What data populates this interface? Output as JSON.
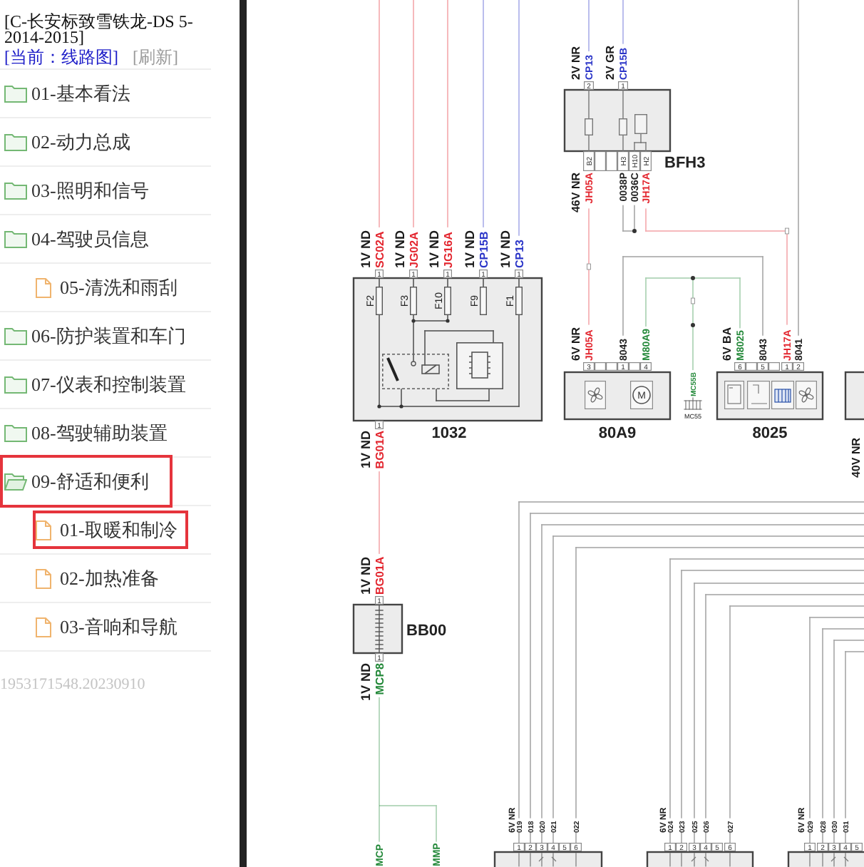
{
  "sidebar": {
    "title_lines": [
      "[C-长安标致雪铁龙-DS 5-",
      "2014-2015]"
    ],
    "current": "[当前：线路图]",
    "refresh": "[刷新]",
    "items": [
      {
        "kind": "folder",
        "label": "01-基本看法",
        "expanded": false,
        "highlighted": false
      },
      {
        "kind": "folder",
        "label": "02-动力总成",
        "expanded": false,
        "highlighted": false
      },
      {
        "kind": "folder",
        "label": "03-照明和信号",
        "expanded": false,
        "highlighted": false
      },
      {
        "kind": "folder",
        "label": "04-驾驶员信息",
        "expanded": false,
        "highlighted": false
      },
      {
        "kind": "file",
        "label": "05-清洗和雨刮",
        "highlighted": false
      },
      {
        "kind": "folder",
        "label": "06-防护装置和车门",
        "expanded": false,
        "highlighted": false
      },
      {
        "kind": "folder",
        "label": "07-仪表和控制装置",
        "expanded": false,
        "highlighted": false
      },
      {
        "kind": "folder",
        "label": "08-驾驶辅助装置",
        "expanded": false,
        "highlighted": false
      },
      {
        "kind": "folder",
        "label": "09-舒适和便利",
        "expanded": true,
        "highlighted": true,
        "children": [
          {
            "kind": "file",
            "label": "01-取暖和制冷",
            "highlighted": true
          },
          {
            "kind": "file",
            "label": "02-加热准备",
            "highlighted": false
          },
          {
            "kind": "file",
            "label": "03-音响和导航",
            "highlighted": false
          }
        ]
      }
    ],
    "footer": "1953171548.20230910"
  },
  "diagram": {
    "components": [
      {
        "kind": "fuse_box",
        "name": "1032",
        "fuses": [
          "F2",
          "F3",
          "F10",
          "F9",
          "F1"
        ],
        "top_connectors": [
          {
            "gauge": "1V ND",
            "wires": [
              {
                "pin": "1",
                "code": "SC02A",
                "color": "#e3262f"
              }
            ]
          },
          {
            "gauge": "1V ND",
            "wires": [
              {
                "pin": "1",
                "code": "JG02A",
                "color": "#e3262f"
              }
            ]
          },
          {
            "gauge": "1V ND",
            "wires": [
              {
                "pin": "1",
                "code": "JG16A",
                "color": "#e3262f"
              }
            ]
          },
          {
            "gauge": "1V ND",
            "wires": [
              {
                "pin": "1",
                "code": "CP15B",
                "color": "#2b35c8"
              }
            ]
          },
          {
            "gauge": "1V ND",
            "wires": [
              {
                "pin": "1",
                "code": "CP13",
                "color": "#2b35c8"
              }
            ]
          }
        ],
        "bottom_connectors": [
          {
            "gauge": "1V ND",
            "wires": [
              {
                "pin": "1",
                "code": "BG01A",
                "color": "#e3262f"
              }
            ]
          }
        ]
      },
      {
        "kind": "module",
        "name": "BFH3",
        "top_connectors": [
          {
            "gauge": "2V NR",
            "wires": [
              {
                "pin": "2",
                "code": "CP13",
                "color": "#2b35c8"
              }
            ]
          },
          {
            "gauge": "2V GR",
            "wires": [
              {
                "pin": "1",
                "code": "CP15B",
                "color": "#2b35c8"
              }
            ]
          }
        ],
        "bottom_connectors": [
          {
            "gauge": "46V NR",
            "wires": [
              {
                "pin": "B2",
                "code": "JH05A",
                "color": "#e3262f"
              },
              {
                "pin": "H3",
                "code": "0038P",
                "color": "#222222"
              },
              {
                "pin": "H10",
                "code": "0036C",
                "color": "#222222"
              },
              {
                "pin": "H2",
                "code": "JH17A",
                "color": "#e3262f"
              }
            ]
          }
        ]
      },
      {
        "kind": "fan_motor",
        "name": "80A9",
        "motor_symbol": "M",
        "top_connectors": [
          {
            "gauge": "6V NR",
            "wires": [
              {
                "pin": "3",
                "code": "JH05A",
                "color": "#e3262f"
              },
              {
                "pin": "1",
                "code": "8043",
                "color": "#222222"
              },
              {
                "pin": "4",
                "code": "M80A9",
                "color": "#24893a"
              }
            ]
          }
        ]
      },
      {
        "kind": "ground",
        "name": "MC55",
        "top_connectors": [
          {
            "wires": [
              {
                "code": "MC55B",
                "color": "#24893a"
              }
            ]
          }
        ]
      },
      {
        "kind": "blower",
        "name": "8025",
        "top_connectors": [
          {
            "gauge": "6V BA",
            "wires": [
              {
                "pin": "6",
                "code": "M8025",
                "color": "#24893a"
              },
              {
                "pin": "5",
                "code": "8043",
                "color": "#222222"
              },
              {
                "pin": "1",
                "code": "JH17A",
                "color": "#e3262f"
              },
              {
                "pin": "2",
                "code": "8041",
                "color": "#222222"
              }
            ]
          }
        ]
      },
      {
        "kind": "partial",
        "bottom_connectors": [
          {
            "gauge": "40V NR"
          }
        ]
      },
      {
        "kind": "heater",
        "name": "BB00",
        "top_connectors": [
          {
            "gauge": "1V ND",
            "wires": [
              {
                "pin": "1",
                "code": "BG01A",
                "color": "#e3262f"
              }
            ]
          }
        ],
        "bottom_connectors": [
          {
            "gauge": "1V ND",
            "wires": [
              {
                "pin": "1",
                "code": "MCP8",
                "color": "#24893a"
              }
            ]
          }
        ]
      },
      {
        "kind": "connector",
        "top_connectors": [
          {
            "gauge": "6V NR",
            "wires": [
              {
                "pin": "1",
                "code": "019",
                "color": "#222222"
              },
              {
                "pin": "2",
                "code": "018",
                "color": "#222222"
              },
              {
                "pin": "3",
                "code": "020",
                "color": "#222222"
              },
              {
                "pin": "4",
                "code": "021",
                "color": "#222222"
              },
              {
                "pin": "5"
              },
              {
                "pin": "6",
                "code": "022",
                "color": "#222222"
              }
            ]
          }
        ]
      },
      {
        "kind": "connector",
        "top_connectors": [
          {
            "gauge": "6V NR",
            "wires": [
              {
                "pin": "1",
                "code": "024",
                "color": "#222222"
              },
              {
                "pin": "2",
                "code": "023",
                "color": "#222222"
              },
              {
                "pin": "3",
                "code": "025",
                "color": "#222222"
              },
              {
                "pin": "4",
                "code": "026",
                "color": "#222222"
              },
              {
                "pin": "5"
              },
              {
                "pin": "6",
                "code": "027",
                "color": "#222222"
              }
            ]
          }
        ]
      },
      {
        "kind": "connector",
        "top_connectors": [
          {
            "gauge": "6V NR",
            "wires": [
              {
                "pin": "1",
                "code": "029",
                "color": "#222222"
              },
              {
                "pin": "2",
                "code": "028",
                "color": "#222222"
              },
              {
                "pin": "3",
                "code": "030",
                "color": "#222222"
              },
              {
                "pin": "4",
                "code": "031",
                "color": "#222222"
              },
              {
                "pin": "5"
              }
            ]
          }
        ]
      }
    ],
    "wire_ends": [
      {
        "code": "MCP",
        "color": "#24893a"
      },
      {
        "code": "MMP",
        "color": "#24893a"
      }
    ]
  }
}
